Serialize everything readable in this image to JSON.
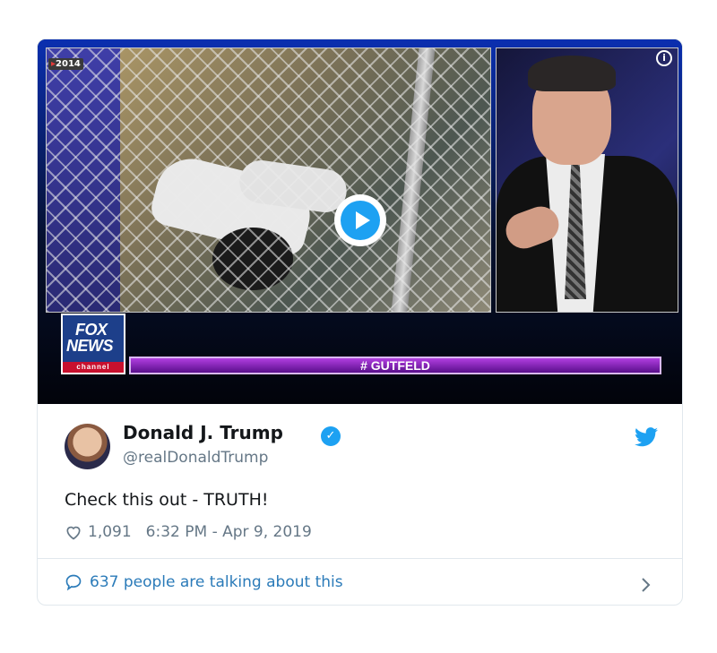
{
  "media": {
    "year_badge": "2014",
    "info_glyph": "i",
    "play_icon": "play-icon",
    "fox_logo_line1": "FOX",
    "fox_logo_line2": "NEWS",
    "fox_logo_channel": "channel",
    "show_hashtag": "# GUTFELD"
  },
  "tweet": {
    "author_name": "Donald J. Trump",
    "verified_glyph": "✓",
    "handle": "@realDonaldTrump",
    "text": "Check this out - TRUTH!",
    "likes": "1,091",
    "timestamp": "6:32 PM - Apr 9, 2019",
    "conversation": "637 people are talking about this"
  },
  "colors": {
    "twitter_blue": "#1da1f2",
    "link_blue": "#2b7bb9",
    "fox_red": "#c8102e",
    "gutfeld_purple": "#8a2bbf"
  }
}
